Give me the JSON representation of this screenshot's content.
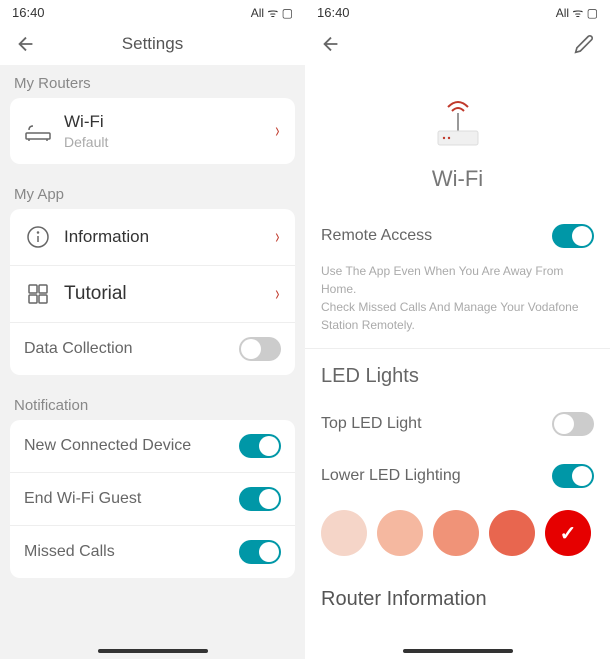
{
  "status": {
    "time": "16:40",
    "indicators": "All ᯤ ▢"
  },
  "left": {
    "title": "Settings",
    "sections": {
      "routers": {
        "label": "My Routers",
        "wifi": {
          "title": "Wi-Fi",
          "subtitle": "Default"
        }
      },
      "app": {
        "label": "My App",
        "information": "Information",
        "tutorial": "Tutorial",
        "data_collection": "Data Collection"
      },
      "notification": {
        "label": "Notification",
        "new_device": "New Connected Device",
        "end_guest": "End Wi-Fi Guest",
        "missed_calls": "Missed Calls"
      }
    }
  },
  "right": {
    "router_name": "Wi-Fi",
    "remote": {
      "label": "Remote Access",
      "hint1": "Use The App Even When You Are Away From Home.",
      "hint2": "Check Missed Calls And Manage Your Vodafone Station Remotely."
    },
    "led": {
      "header": "LED Lights",
      "top": "Top LED Light",
      "lower": "Lower LED Lighting"
    },
    "colors": [
      "#f5d5c8",
      "#f5b8a0",
      "#f09378",
      "#e8664f",
      "#e60000"
    ],
    "selected_color_index": 4,
    "router_info": "Router Information"
  }
}
